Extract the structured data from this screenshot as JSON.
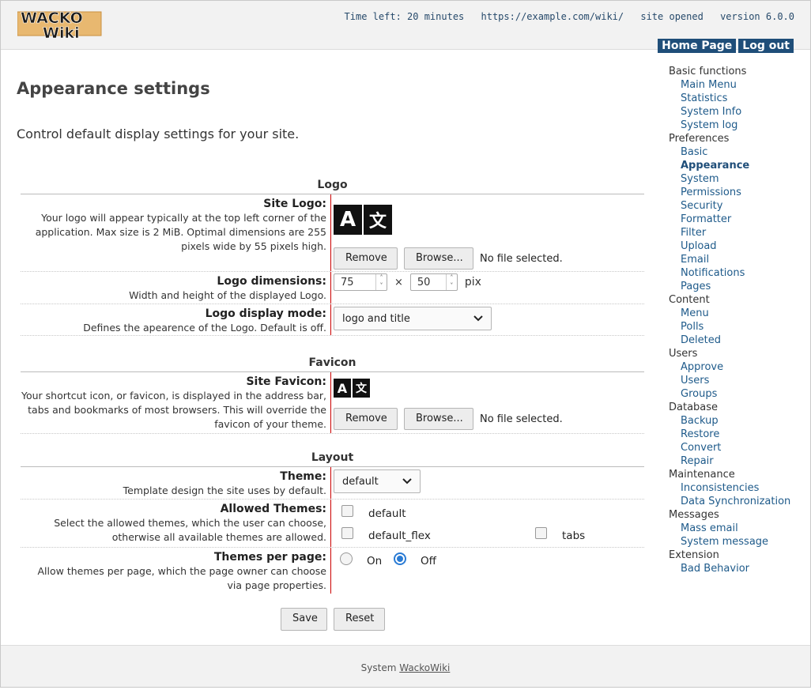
{
  "header": {
    "logo_text": "WackoWiki",
    "time_left": "Time left: 20 minutes",
    "url": "https://example.com/wiki/",
    "site_status": "site opened",
    "version": "version 6.0.0",
    "home_link": "Home Page",
    "logout_link": "Log out"
  },
  "page": {
    "title": "Appearance settings",
    "description": "Control default display settings for your site."
  },
  "sidebar": {
    "sections": [
      {
        "title": "Basic functions",
        "items": [
          "Main Menu",
          "Statistics",
          "System Info",
          "System log"
        ]
      },
      {
        "title": "Preferences",
        "items": [
          "Basic",
          "Appearance",
          "System",
          "Permissions",
          "Security",
          "Formatter",
          "Filter",
          "Upload",
          "Email",
          "Notifications",
          "Pages"
        ]
      },
      {
        "title": "Content",
        "items": [
          "Menu",
          "Polls",
          "Deleted"
        ]
      },
      {
        "title": "Users",
        "items": [
          "Approve",
          "Users",
          "Groups"
        ]
      },
      {
        "title": "Database",
        "items": [
          "Backup",
          "Restore",
          "Convert",
          "Repair"
        ]
      },
      {
        "title": "Maintenance",
        "items": [
          "Inconsistencies",
          "Data Synchronization"
        ]
      },
      {
        "title": "Messages",
        "items": [
          "Mass email",
          "System message"
        ]
      },
      {
        "title": "Extension",
        "items": [
          "Bad Behavior"
        ]
      }
    ],
    "active": "Appearance"
  },
  "form": {
    "logo_section": "Logo",
    "site_logo": {
      "label": "Site Logo:",
      "help": "Your logo will appear typically at the top left corner of the application. Max size is 2 MiB. Optimal dimensions are 255 pixels wide by 55 pixels high.",
      "glyph_a": "A",
      "glyph_b": "文",
      "remove": "Remove",
      "browse": "Browse...",
      "no_file": "No file selected."
    },
    "logo_dimensions": {
      "label": "Logo dimensions:",
      "help": "Width and height of the displayed Logo.",
      "width": "75",
      "times": "×",
      "height": "50",
      "unit": "pix"
    },
    "logo_display": {
      "label": "Logo display mode:",
      "help": "Defines the apearence of the Logo. Default is off.",
      "value": "logo and title"
    },
    "favicon_section": "Favicon",
    "site_favicon": {
      "label": "Site Favicon:",
      "help": "Your shortcut icon, or favicon, is displayed in the address bar, tabs and bookmarks of most browsers. This will override the favicon of your theme.",
      "glyph_a": "A",
      "glyph_b": "文",
      "remove": "Remove",
      "browse": "Browse...",
      "no_file": "No file selected."
    },
    "layout_section": "Layout",
    "theme": {
      "label": "Theme:",
      "help": "Template design the site uses by default.",
      "value": "default"
    },
    "allowed_themes": {
      "label": "Allowed Themes:",
      "help": "Select the allowed themes, which the user can choose, otherwise all available themes are allowed.",
      "options": [
        "default",
        "default_flex",
        "tabs"
      ]
    },
    "themes_per_page": {
      "label": "Themes per page:",
      "help": "Allow themes per page, which the page owner can choose via page properties.",
      "on": "On",
      "off": "Off",
      "selected": "Off"
    },
    "save": "Save",
    "reset": "Reset"
  },
  "footer": {
    "prefix": "System",
    "link": "WackoWiki"
  }
}
